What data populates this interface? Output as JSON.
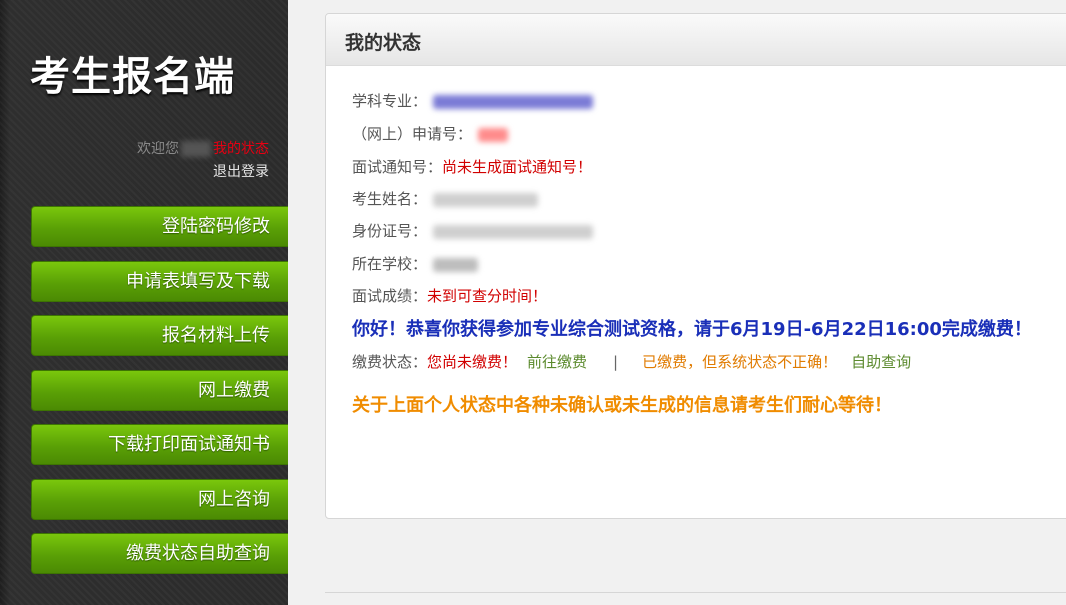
{
  "sidebar": {
    "title": "考生报名端",
    "welcome": "欢迎您",
    "status_link": "我的状态",
    "logout": "退出登录",
    "nav": [
      {
        "label": "登陆密码修改"
      },
      {
        "label": "申请表填写及下载"
      },
      {
        "label": "报名材料上传"
      },
      {
        "label": "网上缴费"
      },
      {
        "label": "下载打印面试通知书"
      },
      {
        "label": "网上咨询"
      },
      {
        "label": "缴费状态自助查询"
      }
    ]
  },
  "panel": {
    "title": "我的状态",
    "fields": {
      "major_label": "学科专业：",
      "app_no_label": "（网上）申请号：",
      "interview_no_label": "面试通知号：",
      "interview_no_value": "尚未生成面试通知号！",
      "name_label": "考生姓名：",
      "id_label": "身份证号：",
      "school_label": "所在学校：",
      "score_label": "面试成绩：",
      "score_value": "未到可查分时间！"
    },
    "notice": "你好！恭喜你获得参加专业综合测试资格，请于6月19日-6月22日16:00完成缴费！",
    "payment": {
      "label": "缴费状态：",
      "unpaid": "您尚未缴费！",
      "go_pay": "前往缴费",
      "separator": "|",
      "paid_issue": "已缴费，但系统状态不正确！",
      "self_query": "自助查询"
    },
    "footer_note": "关于上面个人状态中各种未确认或未生成的信息请考生们耐心等待！"
  }
}
